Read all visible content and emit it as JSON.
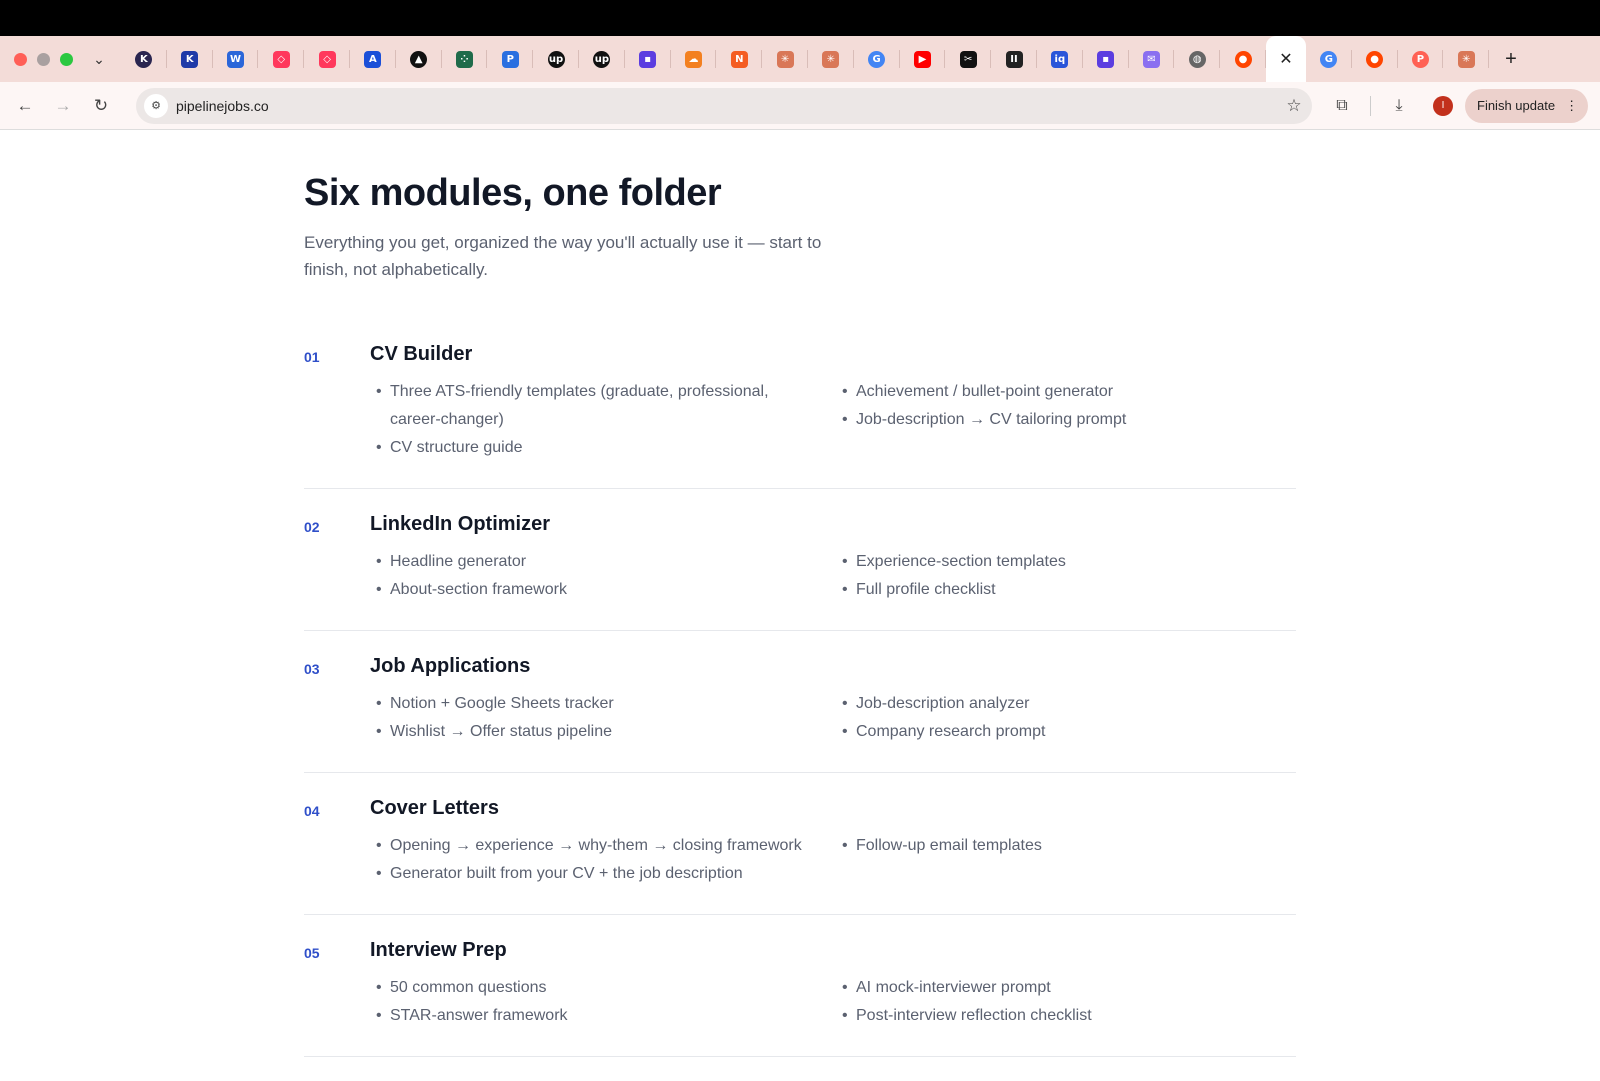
{
  "browser": {
    "url": "pipelinejobs.co",
    "finish_update_label": "Finish update",
    "avatar_letter": "I",
    "tabs": [
      {
        "icon": "k-circle-icon",
        "glyph": "K",
        "color": "#2a2550",
        "round": true
      },
      {
        "icon": "k-letter-icon",
        "glyph": "K",
        "color": "#1f3aa8",
        "round": false
      },
      {
        "icon": "word-icon",
        "glyph": "W",
        "color": "#2b66d9",
        "round": false
      },
      {
        "icon": "airbnb-icon",
        "glyph": "◇",
        "color": "#ff385c",
        "round": false
      },
      {
        "icon": "airbnb-icon",
        "glyph": "◇",
        "color": "#ff385c",
        "round": false
      },
      {
        "icon": "a-logo-icon",
        "glyph": "A",
        "color": "#1b4fd8",
        "round": false
      },
      {
        "icon": "triangle-icon",
        "glyph": "▲",
        "color": "#111111",
        "round": true
      },
      {
        "icon": "dots-icon",
        "glyph": "⁘",
        "color": "#1f6b4a",
        "round": false
      },
      {
        "icon": "paypal-icon",
        "glyph": "P",
        "color": "#2a6fe0",
        "round": false
      },
      {
        "icon": "upwork-icon",
        "glyph": "up",
        "color": "#111111",
        "round": true
      },
      {
        "icon": "upwork-icon",
        "glyph": "up",
        "color": "#111111",
        "round": true
      },
      {
        "icon": "chat-icon",
        "glyph": "▪",
        "color": "#5b3de0",
        "round": false
      },
      {
        "icon": "cloudflare-icon",
        "glyph": "☁",
        "color": "#f38020",
        "round": false
      },
      {
        "icon": "n-logo-icon",
        "glyph": "N",
        "color": "#f45d22",
        "round": false
      },
      {
        "icon": "claude-icon",
        "glyph": "✳",
        "color": "#d97757",
        "round": false
      },
      {
        "icon": "claude-icon",
        "glyph": "✳",
        "color": "#d97757",
        "round": false
      },
      {
        "icon": "google-icon",
        "glyph": "G",
        "color": "#4285f4",
        "round": true
      },
      {
        "icon": "youtube-icon",
        "glyph": "▶",
        "color": "#ff0000",
        "round": false
      },
      {
        "icon": "capcut-icon",
        "glyph": "✂",
        "color": "#111111",
        "round": false
      },
      {
        "icon": "pause-icon",
        "glyph": "II",
        "color": "#222222",
        "round": false
      },
      {
        "icon": "iq-icon",
        "glyph": "iq",
        "color": "#2a55d9",
        "round": false
      },
      {
        "icon": "chat-icon",
        "glyph": "▪",
        "color": "#5b3de0",
        "round": false
      },
      {
        "icon": "mail-icon",
        "glyph": "✉",
        "color": "#8a6ff0",
        "round": false
      },
      {
        "icon": "globe-icon",
        "glyph": "◍",
        "color": "#666666",
        "round": true
      },
      {
        "icon": "reddit-icon",
        "glyph": "●",
        "color": "#ff4500",
        "round": true
      }
    ],
    "tabs_after_active": [
      {
        "icon": "google-icon",
        "glyph": "G",
        "color": "#4285f4",
        "round": true
      },
      {
        "icon": "reddit-icon",
        "glyph": "●",
        "color": "#ff4500",
        "round": true
      },
      {
        "icon": "p-logo-icon",
        "glyph": "P",
        "color": "#ff6154",
        "round": true
      },
      {
        "icon": "claude-icon",
        "glyph": "✳",
        "color": "#d97757",
        "round": false
      }
    ]
  },
  "page": {
    "title": "Six modules, one folder",
    "subtitle": "Everything you get, organized the way you'll actually use it — start to finish, not alphabetically.",
    "modules": [
      {
        "num": "01",
        "title": "CV Builder",
        "left": [
          "Three ATS-friendly templates (graduate, professional, career-changer)",
          "CV structure guide"
        ],
        "right": [
          "Achievement / bullet-point generator",
          "Job-description → CV tailoring prompt"
        ]
      },
      {
        "num": "02",
        "title": "LinkedIn Optimizer",
        "left": [
          "Headline generator",
          "About-section framework"
        ],
        "right": [
          "Experience-section templates",
          "Full profile checklist"
        ]
      },
      {
        "num": "03",
        "title": "Job Applications",
        "left": [
          "Notion + Google Sheets tracker",
          "Wishlist → Offer status pipeline"
        ],
        "right": [
          "Job-description analyzer",
          "Company research prompt"
        ]
      },
      {
        "num": "04",
        "title": "Cover Letters",
        "left": [
          "Opening → experience → why-them → closing framework",
          "Generator built from your CV + the job description"
        ],
        "right": [
          "Follow-up email templates"
        ]
      },
      {
        "num": "05",
        "title": "Interview Prep",
        "left": [
          "50 common questions",
          "STAR-answer framework"
        ],
        "right": [
          "AI mock-interviewer prompt",
          "Post-interview reflection checklist"
        ]
      }
    ]
  }
}
